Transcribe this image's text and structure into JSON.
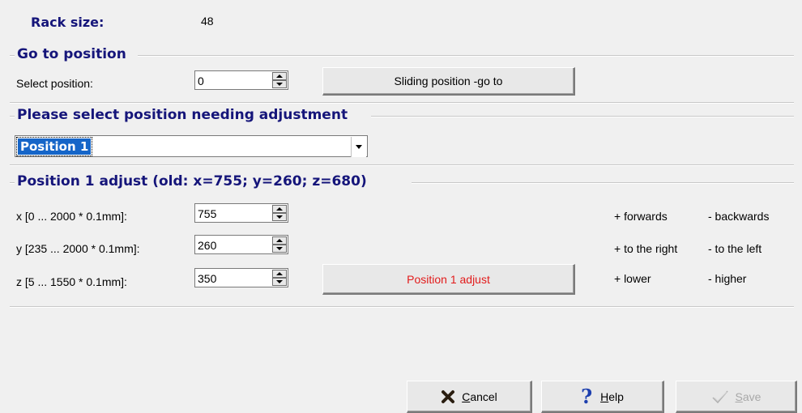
{
  "rack": {
    "label": "Rack size:",
    "value": "48"
  },
  "goto_group": {
    "title": "Go to position",
    "select_label": "Select position:",
    "select_value": "0",
    "button_label": "Sliding position - go to",
    "button_underline": "g",
    "button_prefix": "Sliding position - ",
    "button_suffix": "o to"
  },
  "select_group": {
    "title": "Please select position needing adjustment",
    "selected": "Position 1"
  },
  "adjust_group": {
    "title": "Position 1  adjust  (old: x=755; y=260; z=680)",
    "rows": [
      {
        "label": "x [0 ... 2000 * 0.1mm]:",
        "value": "755",
        "plus": "+ forwards",
        "minus": "- backwards"
      },
      {
        "label": "y [235 ... 2000 * 0.1mm]:",
        "value": "260",
        "plus": "+ to the right",
        "minus": "- to the left"
      },
      {
        "label": "z [5 ... 1550 * 0.1mm]:",
        "value": "350",
        "plus": "+ lower",
        "minus": "- higher"
      }
    ],
    "adjust_button": "Position 1  adjust",
    "accent_color": "#e21b1b"
  },
  "footer": {
    "cancel": {
      "underline": "C",
      "rest": "ancel",
      "icon": "x-icon"
    },
    "help": {
      "underline": "H",
      "rest": "elp",
      "icon": "question-icon"
    },
    "save": {
      "underline": "S",
      "rest": "ave",
      "icon": "checkmark-icon"
    }
  }
}
